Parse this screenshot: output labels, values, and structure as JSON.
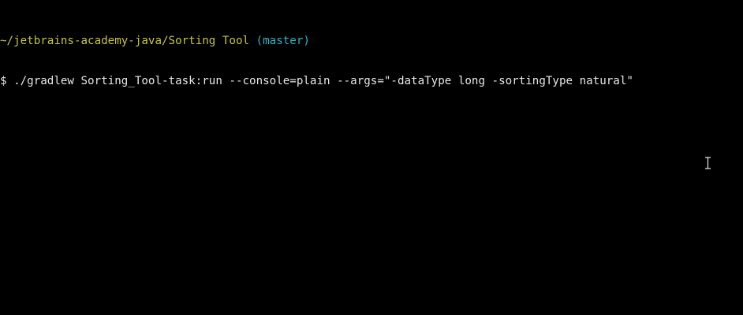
{
  "terminal": {
    "cwd": "~/jetbrains-academy-java/Sorting Tool",
    "branch": "(master)",
    "prompt_symbol": "$",
    "command": "./gradlew Sorting_Tool-task:run --console=plain --args=\"-dataType long -sortingType natural\""
  },
  "colors": {
    "background": "#000000",
    "path": "#c7c43f",
    "branch": "#2fb4c6",
    "text": "#e6e6e6"
  },
  "cursor": {
    "icon": "text-cursor-ibeam-icon"
  }
}
